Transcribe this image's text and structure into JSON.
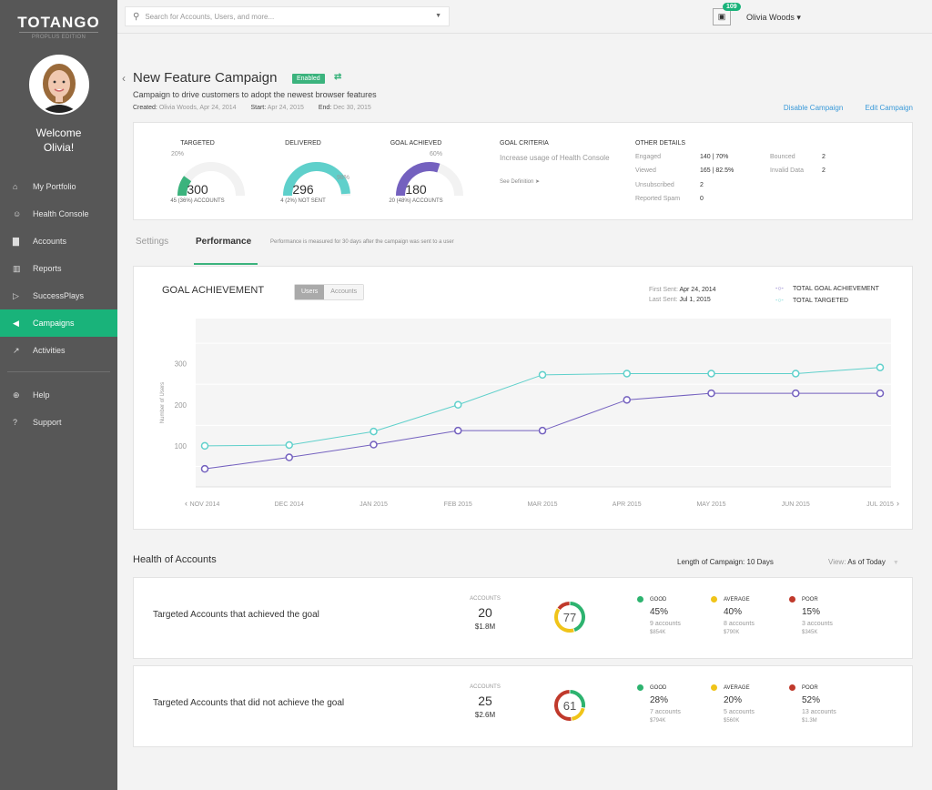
{
  "sidebar": {
    "logo": "TOTANGO",
    "edition": "PROPLUS EDITION",
    "welcome_line1": "Welcome",
    "welcome_line2": "Olivia!",
    "items": [
      {
        "label": "My Portfolio",
        "icon": "home-icon",
        "glyph": "⌂"
      },
      {
        "label": "Health Console",
        "icon": "smiley-icon",
        "glyph": "☺"
      },
      {
        "label": "Accounts",
        "icon": "briefcase-icon",
        "glyph": "▇"
      },
      {
        "label": "Reports",
        "icon": "bar-chart-icon",
        "glyph": "▥"
      },
      {
        "label": "SuccessPlays",
        "icon": "play-icon",
        "glyph": "▷"
      },
      {
        "label": "Campaigns",
        "icon": "megaphone-icon",
        "glyph": "◀"
      },
      {
        "label": "Activities",
        "icon": "line-chart-icon",
        "glyph": "↗"
      }
    ],
    "bottom_items": [
      {
        "label": "Help",
        "icon": "lifebuoy-icon",
        "glyph": "⊕"
      },
      {
        "label": "Support",
        "icon": "question-icon",
        "glyph": "?"
      }
    ],
    "active": "Campaigns"
  },
  "topbar": {
    "search_placeholder": "Search for Accounts, Users, and more...",
    "notification_count": "109",
    "user_name": "Olivia Woods ▾"
  },
  "campaign": {
    "title": "New Feature Campaign",
    "status": "Enabled",
    "description": "Campaign to drive customers to adopt the newest browser features",
    "created_label": "Created:",
    "created_value": "Olivia Woods, Apr 24, 2014",
    "start_label": "Start:",
    "start_value": "Apr 24, 2015",
    "end_label": "End:",
    "end_value": "Dec 30, 2015",
    "disable_label": "Disable Campaign",
    "edit_label": "Edit Campaign"
  },
  "stats": {
    "targeted": {
      "title": "TARGETED",
      "value": "300",
      "pct_label": "20%",
      "pct": 0.2,
      "sub": "45 (36%) ACCOUNTS",
      "color": "#3bb37d"
    },
    "delivered": {
      "title": "DELIVERED",
      "value": "296",
      "pct_label": "98%",
      "pct": 0.98,
      "sub": "4 (2%) NOT SENT",
      "color": "#5fd0cb"
    },
    "goal": {
      "title": "GOAL ACHIEVED",
      "value": "180",
      "pct_label": "60%",
      "pct": 0.6,
      "sub": "20 (48%) ACCOUNTS",
      "color": "#7461bf"
    },
    "criteria_title": "GOAL CRITERIA",
    "criteria_text": "Increase usage of Health Console",
    "criteria_link": "See Definition",
    "other_title": "OTHER DETAILS",
    "other": [
      {
        "label": "Engaged",
        "value": "140  |  70%"
      },
      {
        "label": "Viewed",
        "value": "165  |  82.5%"
      },
      {
        "label": "Unsubscribed",
        "value": "2"
      },
      {
        "label": "Reported Spam",
        "value": "0"
      },
      {
        "label": "Bounced",
        "value": "2"
      },
      {
        "label": "Invalid Data",
        "value": "2"
      }
    ]
  },
  "tabs": {
    "settings": "Settings",
    "performance": "Performance",
    "note": "Performance is measured for 30 days after the campaign was sent to a user"
  },
  "goal_chart": {
    "title": "GOAL ACHIEVEMENT",
    "toggle_users": "Users",
    "toggle_accounts": "Accounts",
    "first_sent_label": "First Sent:",
    "first_sent_value": "Apr 24, 2014",
    "last_sent_label": "Last Sent:",
    "last_sent_value": "Jul 1, 2015"
  },
  "chart_data": {
    "type": "line",
    "title": "GOAL ACHIEVEMENT",
    "xlabel": "",
    "ylabel": "Number of Users",
    "categories": [
      "NOV 2014",
      "DEC 2014",
      "JAN 2015",
      "FEB 2015",
      "MAR 2015",
      "APR 2015",
      "MAY 2015",
      "JUN 2015",
      "JUL 2015"
    ],
    "yticks": [
      100,
      200,
      300
    ],
    "ylim": [
      0,
      410
    ],
    "grid": true,
    "legend": "top-right",
    "series": [
      {
        "name": "TOTAL GOAL ACHIEVEMENT",
        "color": "#7461bf",
        "values": [
          44,
          72,
          103,
          137,
          137,
          212,
          228,
          228,
          228
        ]
      },
      {
        "name": "TOTAL TARGETED",
        "color": "#5fd0cb",
        "values": [
          100,
          102,
          135,
          200,
          273,
          276,
          276,
          276,
          291
        ]
      }
    ]
  },
  "health": {
    "title": "Health of Accounts",
    "length": "Length of Campaign: 10 Days",
    "view_label": "View:",
    "view_value": "As of Today",
    "rows": [
      {
        "label": "Targeted Accounts that achieved the goal",
        "accounts_label": "ACCOUNTS",
        "accounts": "20",
        "money": "$1.8M",
        "score": "77",
        "segments": [
          {
            "name": "GOOD",
            "pct": "45%",
            "fraction": 0.45,
            "accounts": "9 accounts",
            "money": "$854K",
            "color": "#2db36f"
          },
          {
            "name": "AVERAGE",
            "pct": "40%",
            "fraction": 0.4,
            "accounts": "8 accounts",
            "money": "$790K",
            "color": "#f0c419"
          },
          {
            "name": "POOR",
            "pct": "15%",
            "fraction": 0.15,
            "accounts": "3 accounts",
            "money": "$345K",
            "color": "#c0392b"
          }
        ]
      },
      {
        "label": "Targeted Accounts that did not achieve the goal",
        "accounts_label": "ACCOUNTS",
        "accounts": "25",
        "money": "$2.6M",
        "score": "61",
        "segments": [
          {
            "name": "GOOD",
            "pct": "28%",
            "fraction": 0.28,
            "accounts": "7 accounts",
            "money": "$794K",
            "color": "#2db36f"
          },
          {
            "name": "AVERAGE",
            "pct": "20%",
            "fraction": 0.2,
            "accounts": "5 accounts",
            "money": "$560K",
            "color": "#f0c419"
          },
          {
            "name": "POOR",
            "pct": "52%",
            "fraction": 0.52,
            "accounts": "13 accounts",
            "money": "$1.3M",
            "color": "#c0392b"
          }
        ]
      }
    ]
  }
}
